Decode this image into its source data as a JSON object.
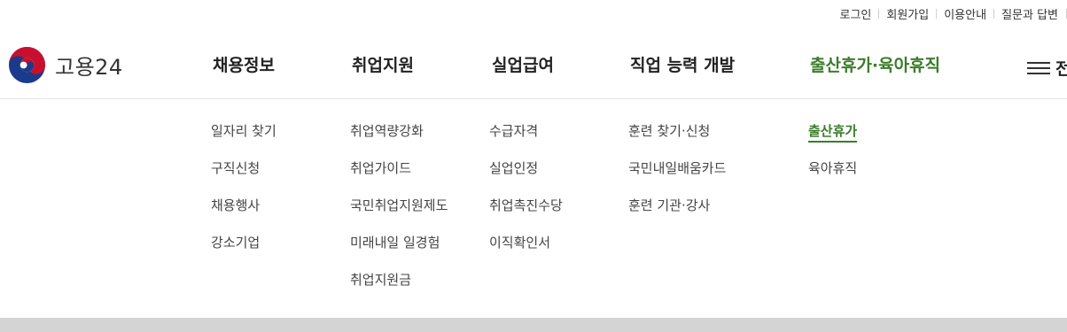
{
  "util": {
    "login": "로그인",
    "signup": "회원가입",
    "guide": "이용안내",
    "qna": "질문과 답변"
  },
  "logo": {
    "text": "고용24"
  },
  "gnb": {
    "items": [
      {
        "label": "채용정보"
      },
      {
        "label": "취업지원"
      },
      {
        "label": "실업급여"
      },
      {
        "label": "직업 능력 개발"
      },
      {
        "label": "출산휴가·육아휴직"
      }
    ],
    "all_menu_label": "전",
    "active_index": 4
  },
  "mega": {
    "columns": [
      {
        "items": [
          "일자리 찾기",
          "구직신청",
          "채용행사",
          "강소기업"
        ]
      },
      {
        "items": [
          "취업역량강화",
          "취업가이드",
          "국민취업지원제도",
          "미래내일 일경험",
          "취업지원금"
        ]
      },
      {
        "items": [
          "수급자격",
          "실업인정",
          "취업촉진수당",
          "이직확인서"
        ]
      },
      {
        "items": [
          "훈련 찾기·신청",
          "국민내일배움카드",
          "훈련 기관·강사"
        ]
      },
      {
        "items": [
          "출산휴가",
          "육아휴직"
        ]
      }
    ],
    "active_item": "출산휴가"
  },
  "colors": {
    "accent": "#3a7d2a",
    "logo_red": "#c8102e",
    "logo_blue": "#1a3a8c"
  },
  "icons": [
    "korea-government-emblem-icon",
    "hamburger-menu-icon"
  ]
}
